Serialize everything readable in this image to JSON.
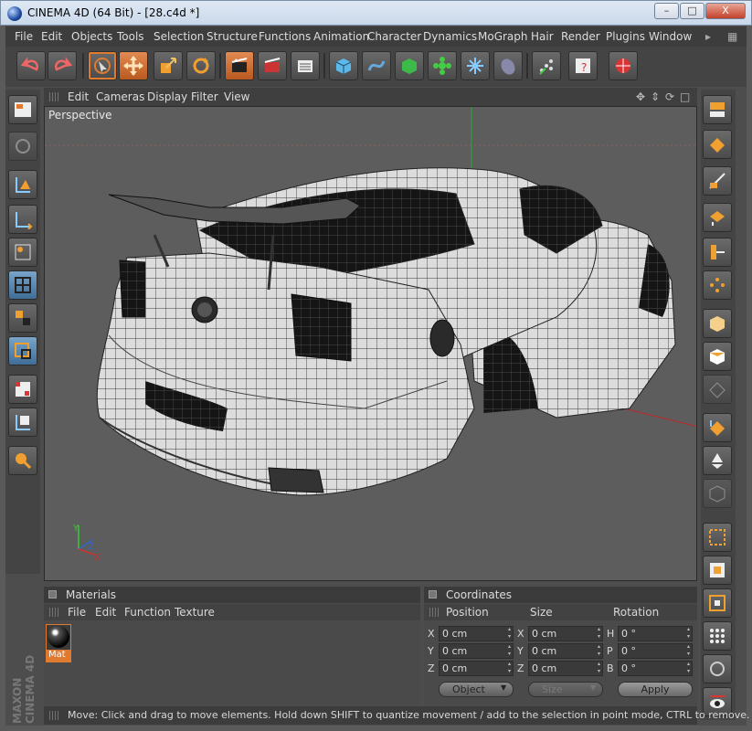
{
  "window": {
    "title": "CINEMA 4D (64 Bit) - [28.c4d *]",
    "min": "–",
    "max": "□",
    "close": "X"
  },
  "menu": [
    "File",
    "Edit",
    "Objects",
    "Tools",
    "Selection",
    "Structure",
    "Functions",
    "Animation",
    "Character",
    "Dynamics",
    "MoGraph",
    "Hair",
    "Render",
    "Plugins",
    "Window"
  ],
  "toolbar_icons": [
    "undo-icon",
    "redo-icon",
    "live-selection-icon",
    "move-icon",
    "scale-icon",
    "rotate-icon",
    "render-view-icon",
    "render-picture-viewer-icon",
    "edit-render-settings-icon",
    "cube-icon",
    "spline-pen-icon",
    "nurbs-icon",
    "array-icon",
    "deformer-icon",
    "environment-icon",
    "camera-icon",
    "mograph-cloner-icon",
    "python-script-icon",
    "web-browser-icon"
  ],
  "viewport": {
    "menu": [
      "Edit",
      "Cameras",
      "Display",
      "Filter",
      "View"
    ],
    "label": "Perspective",
    "axes": {
      "y": "Y",
      "z": "Z",
      "x": "X"
    }
  },
  "materials": {
    "title": "Materials",
    "menu": [
      "File",
      "Edit",
      "Function",
      "Texture"
    ],
    "items": [
      {
        "name": "Mat"
      }
    ]
  },
  "coordinates": {
    "title": "Coordinates",
    "headers": {
      "position": "Position",
      "size": "Size",
      "rotation": "Rotation"
    },
    "rows": [
      {
        "pos_axis": "X",
        "pos": "0 cm",
        "size_axis": "X",
        "size": "0 cm",
        "rot_axis": "H",
        "rot": "0 °"
      },
      {
        "pos_axis": "Y",
        "pos": "0 cm",
        "size_axis": "Y",
        "size": "0 cm",
        "rot_axis": "P",
        "rot": "0 °"
      },
      {
        "pos_axis": "Z",
        "pos": "0 cm",
        "size_axis": "Z",
        "size": "0 cm",
        "rot_axis": "B",
        "rot": "0 °"
      }
    ],
    "mode": "Object",
    "size_mode": "Size",
    "apply": "Apply"
  },
  "status": "Move: Click and drag to move elements. Hold down SHIFT to quantize movement / add to the selection in point mode, CTRL to remove.",
  "brand": {
    "line1": "MAXON",
    "line2": "CINEMA 4D"
  },
  "colors": {
    "accent": "#e07a2e",
    "selected_tool": "#7aa4c9",
    "viewport_bg": "#5d5d5d"
  }
}
